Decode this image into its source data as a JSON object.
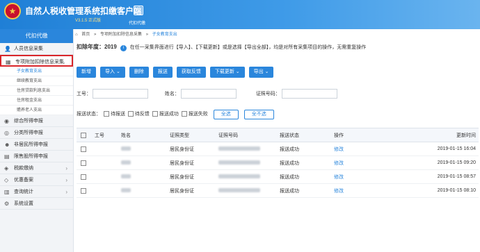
{
  "header": {
    "title": "自然人税收管理系统扣缴客户端",
    "version": "V3.1.5 正式版",
    "corp_label": "代扣代缴"
  },
  "sidebar": {
    "head": "代扣代缴",
    "items": [
      {
        "label": "人员信息采集"
      },
      {
        "label": "专项附加扣除信息采集"
      }
    ],
    "sub_items": [
      {
        "label": "子女教育支出"
      },
      {
        "label": "继续教育支出"
      },
      {
        "label": "住房贷款利息支出"
      },
      {
        "label": "住房租金支出"
      },
      {
        "label": "赡养老人支出"
      }
    ],
    "bottom_items": [
      {
        "label": "综合所得申报"
      },
      {
        "label": "分类所得申报"
      },
      {
        "label": "非居民所得申报"
      },
      {
        "label": "限售股所得申报"
      },
      {
        "label": "税款缴纳"
      },
      {
        "label": "优惠备案"
      },
      {
        "label": "查询统计"
      },
      {
        "label": "系统设置"
      }
    ]
  },
  "breadcrumb": {
    "home": "首页",
    "level1": "专项附加扣除信息采集",
    "level2": "子女教育支出"
  },
  "year": {
    "label": "扣除年度：2019",
    "hint": "在任一采集界面进行【导入】、【下载更新】或是选择【导出全部】，均是对所有采集项目的操作，无需重复操作"
  },
  "toolbar": {
    "add": "新增",
    "import": "导入",
    "delete": "删除",
    "report": "报送",
    "feedback": "获取反馈",
    "download": "下载更新",
    "export": "导出"
  },
  "filters": {
    "job_no": "工号：",
    "name": "姓名：",
    "id_no": "证照号码：",
    "status_label": "报送状态：",
    "s1": "待报送",
    "s2": "待反馈",
    "s3": "报送成功",
    "s4": "报送失败",
    "select_all": "全选",
    "select_none": "全不选"
  },
  "table": {
    "headers": [
      "工号",
      "姓名",
      "证照类型",
      "证照号码",
      "报送状态",
      "操作",
      "更新时间"
    ],
    "rows": [
      {
        "id_type": "居民身份证",
        "status": "报送成功",
        "op": "修改",
        "time": "2019-01-15 16:04"
      },
      {
        "id_type": "居民身份证",
        "status": "报送成功",
        "op": "修改",
        "time": "2019-01-15 09:20"
      },
      {
        "id_type": "居民身份证",
        "status": "报送成功",
        "op": "修改",
        "time": "2019-01-15 08:57"
      },
      {
        "id_type": "居民身份证",
        "status": "报送成功",
        "op": "修改",
        "time": "2019-01-15 08:10"
      }
    ]
  }
}
